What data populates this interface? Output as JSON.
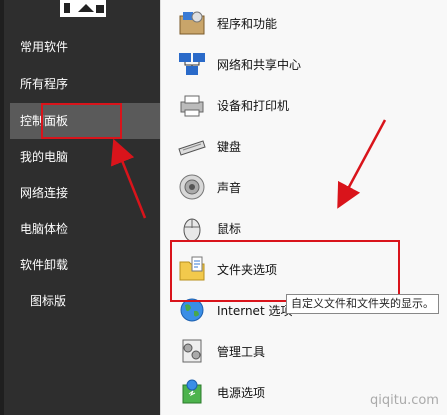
{
  "left_menu": {
    "items": [
      {
        "label": "常用软件"
      },
      {
        "label": "所有程序"
      },
      {
        "label": "控制面板"
      },
      {
        "label": "我的电脑"
      },
      {
        "label": "网络连接"
      },
      {
        "label": "电脑体检"
      },
      {
        "label": "软件卸载"
      },
      {
        "label": "图标版"
      }
    ],
    "active_index": 2
  },
  "right_panel": {
    "items": [
      {
        "label": "程序和功能",
        "icon": "programs-icon"
      },
      {
        "label": "网络和共享中心",
        "icon": "network-sharing-icon"
      },
      {
        "label": "设备和打印机",
        "icon": "devices-printers-icon"
      },
      {
        "label": "键盘",
        "icon": "keyboard-icon"
      },
      {
        "label": "声音",
        "icon": "speaker-icon"
      },
      {
        "label": "鼠标",
        "icon": "mouse-icon"
      },
      {
        "label": "文件夹选项",
        "icon": "folder-options-icon"
      },
      {
        "label": "Internet 选项",
        "icon": "internet-icon"
      },
      {
        "label": "管理工具",
        "icon": "admin-tools-icon"
      },
      {
        "label": "电源选项",
        "icon": "power-options-icon"
      }
    ]
  },
  "tooltip": {
    "text": "自定义文件和文件夹的显示。"
  },
  "watermark": {
    "text": "qiqitu.com"
  },
  "colors": {
    "left_bg": "#2e2e2e",
    "highlight": "#5a5a5a",
    "annotation_red": "#d9141b"
  }
}
